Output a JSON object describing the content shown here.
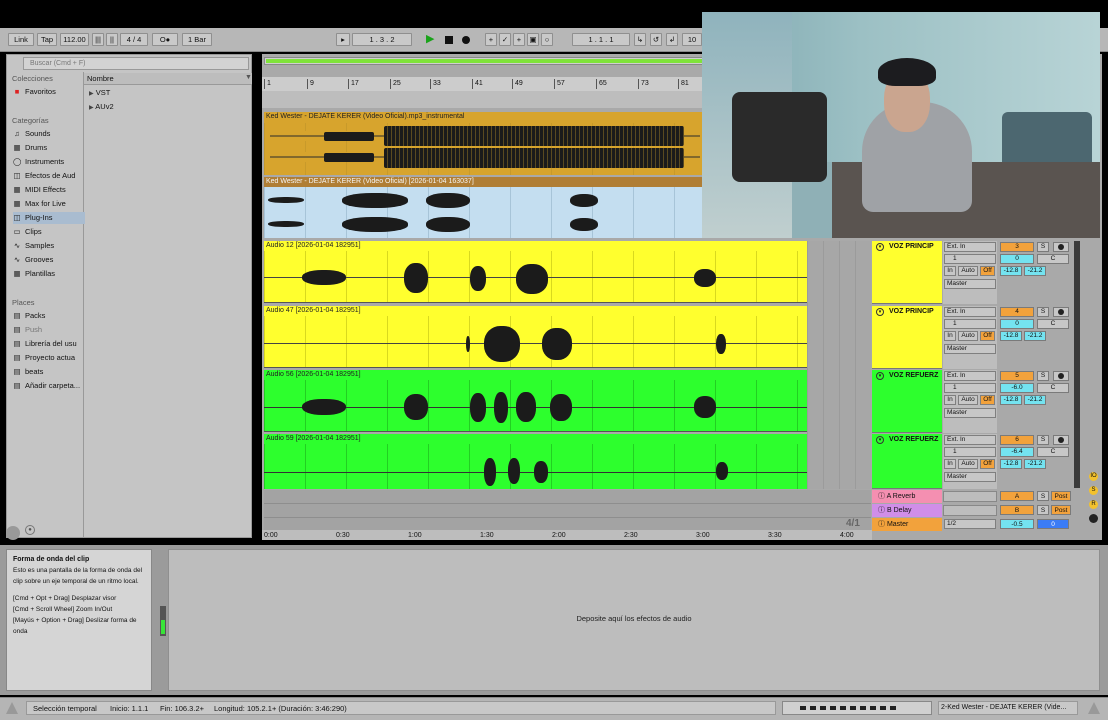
{
  "transport": {
    "link": "Link",
    "tap": "Tap",
    "tempo": "112.00",
    "meter": "4 / 4",
    "metro": "O●",
    "quant": "1 Bar",
    "position": "1 .   3 .   2",
    "loop_start": "1 .   1 .   1",
    "loop_len": "10"
  },
  "browser": {
    "search_placeholder": "Buscar (Cmd + F)",
    "col_header": "Nombre",
    "collections_header": "Colecciones",
    "favorites": "Favoritos",
    "categories_header": "Categorías",
    "categories": [
      "Sounds",
      "Drums",
      "Instruments",
      "Efectos de Aud",
      "MIDI Effects",
      "Max for Live",
      "Plug-Ins",
      "Clips",
      "Samples",
      "Grooves",
      "Plantillas"
    ],
    "places_header": "Places",
    "places": [
      "Packs",
      "Push",
      "Librería del usu",
      "Proyecto actua",
      "beats",
      "Añadir carpeta..."
    ],
    "content": [
      "VST",
      "AUv2"
    ]
  },
  "ruler": {
    "bars": [
      "1",
      "9",
      "17",
      "25",
      "33",
      "41",
      "49",
      "57",
      "65",
      "73",
      "81"
    ],
    "times": [
      "0:00",
      "0:30",
      "1:00",
      "1:30",
      "2:00",
      "2:30",
      "3:00",
      "3:30",
      "4:00"
    ],
    "zoom": "4/1"
  },
  "tracks": [
    {
      "clip": "Ked Wester - DEJATE KERER (Video Oficial).mp3_instrumental"
    },
    {
      "clip": "Ked Wester - DEJATE KERER (Video Oficial) [2026-01-04 163037]"
    },
    {
      "clip": "Audio 12 [2026-01-04 182951]",
      "name": "VOZ PRINCIP",
      "input": "Ext. In",
      "channel": "1",
      "num": "3",
      "s": "S",
      "vol": "0",
      "pan": "C",
      "in": "In",
      "auto": "Auto",
      "off": "Off",
      "peak_l": "-12.8",
      "peak_r": "-21.2",
      "out": "Master"
    },
    {
      "clip": "Audio 47 [2026-01-04 182951]",
      "name": "VOZ PRINCIP",
      "input": "Ext. In",
      "channel": "1",
      "num": "4",
      "s": "S",
      "vol": "0",
      "pan": "C",
      "in": "In",
      "auto": "Auto",
      "off": "Off",
      "peak_l": "-12.8",
      "peak_r": "-21.2",
      "out": "Master"
    },
    {
      "clip": "Audio 56 [2026-01-04 182951]",
      "name": "VOZ REFUERZ",
      "input": "Ext. In",
      "channel": "1",
      "num": "5",
      "s": "S",
      "vol": "-6.0",
      "pan": "C",
      "in": "In",
      "auto": "Auto",
      "off": "Off",
      "peak_l": "-12.8",
      "peak_r": "-21.2",
      "out": "Master"
    },
    {
      "clip": "Audio 59 [2026-01-04 182951]",
      "name": "VOZ REFUERZ",
      "input": "Ext. In",
      "channel": "1",
      "num": "6",
      "s": "S",
      "vol": "-6.4",
      "pan": "C",
      "in": "In",
      "auto": "Auto",
      "off": "Off",
      "peak_l": "-12.8",
      "peak_r": "-21.2",
      "out": "Master"
    }
  ],
  "returns": [
    {
      "name": "A Reverb",
      "letter": "A",
      "s": "S",
      "post": "Post"
    },
    {
      "name": "B Delay",
      "letter": "B",
      "s": "S",
      "post": "Post"
    }
  ],
  "master": {
    "name": "Master",
    "cue": "1/2",
    "vol": "-0.5",
    "pan": "0"
  },
  "info": {
    "title": "Forma de onda del clip",
    "body": "Esto es una pantalla de la forma de onda del clip sobre un eje temporal de un ritmo local.",
    "hint1": "[Cmd + Opt + Drag] Desplazar visor",
    "hint2": "[Cmd + Scroll Wheel] Zoom In/Out",
    "hint3": "[Mayús + Option + Drag] Deslizar forma de onda"
  },
  "devices": {
    "drop_hint": "Deposite aquí los efectos de audio"
  },
  "status": {
    "label": "Selección temporal",
    "start": "Inicio: 1.1.1",
    "end": "Fin: 106.3.2+",
    "length": "Longitud: 105.2.1+ (Duración: 3:46:290)",
    "track": "2-Ked Wester - DEJATE KERER (Vide..."
  },
  "colors": {
    "yellow": "#ffff2e",
    "green": "#2dff2d",
    "orange": "#d7a42d",
    "lightblue": "#c4def0"
  },
  "icons": [
    "play-icon",
    "stop-icon",
    "record-icon",
    "folder-icon",
    "headphone-icon",
    "chevron-down-icon"
  ]
}
